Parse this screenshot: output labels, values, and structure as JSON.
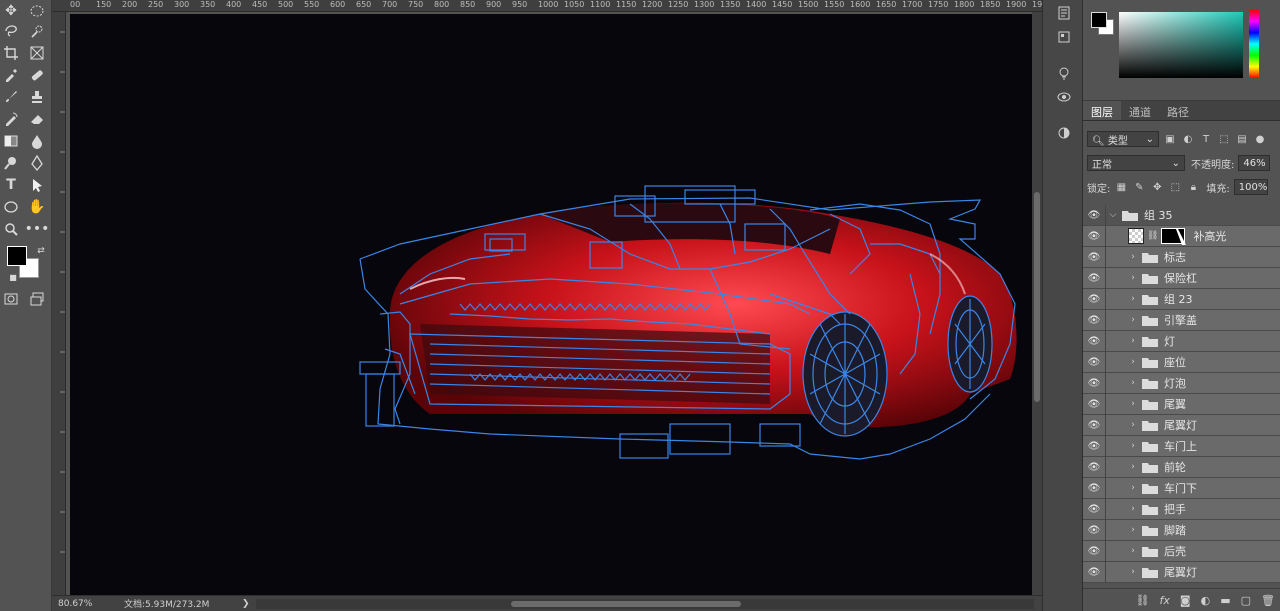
{
  "ruler": {
    "top_ticks": [
      "00",
      "150",
      "200",
      "250",
      "300",
      "350",
      "400",
      "450",
      "500",
      "550",
      "600",
      "650",
      "700",
      "750",
      "800",
      "850",
      "900",
      "950",
      "1000",
      "1050",
      "1100",
      "1150",
      "1200",
      "1250",
      "1300",
      "1350",
      "1400",
      "1450",
      "1500",
      "1550",
      "1600",
      "1650",
      "1700",
      "1750",
      "1800",
      "1850",
      "1900",
      "1950"
    ]
  },
  "statusbar": {
    "zoom": "80.67%",
    "doc": "文档:5.93M/273.2M",
    "arrow": "❯"
  },
  "tools": {
    "names": [
      "move-icon",
      "marquee-icon",
      "lasso-icon",
      "quick-select-icon",
      "crop-icon",
      "frame-icon",
      "eyedropper-icon",
      "healing-icon",
      "brush-icon",
      "stamp-icon",
      "history-brush-icon",
      "eraser-icon",
      "gradient-icon",
      "blur-icon",
      "dodge-icon",
      "pen-icon",
      "type-icon",
      "path-select-icon",
      "ellipse-icon",
      "hand-icon",
      "zoom-icon",
      "more-icon"
    ]
  },
  "layers_panel": {
    "tabs": [
      "图层",
      "通道",
      "路径"
    ],
    "filter_label": "类型",
    "blend_mode": "正常",
    "opacity_label": "不透明度:",
    "opacity_value": "46%",
    "lock_label": "锁定:",
    "fill_label": "填充:",
    "fill_value": "100%",
    "group": {
      "name": "组 35"
    },
    "adjustment_layer": {
      "name": "补高光"
    },
    "folders": [
      "标志",
      "保险杠",
      "组 23",
      "引擎盖",
      "灯",
      "座位",
      "灯泡",
      "尾翼",
      "尾翼灯",
      "车门上",
      "前轮",
      "车门下",
      "把手",
      "脚踏",
      "后壳",
      "尾翼灯"
    ]
  },
  "colors": {
    "accent_blue": "#3a86e8",
    "car_red": "#c8121a",
    "canvas_bg": "#06060c"
  }
}
